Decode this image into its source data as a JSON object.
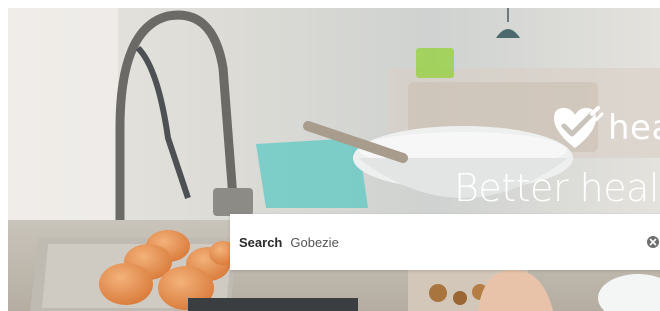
{
  "hero": {
    "background": "kitchen-photo-eggs-and-faucet",
    "brand": {
      "logo_icon": "heart-check-icon",
      "name": "hea"
    },
    "tagline": "Better heal"
  },
  "search": {
    "label": "Search",
    "value": "Gobezie",
    "clear_icon": "clear-circle-icon"
  },
  "colors": {
    "brand_text": "#ffffff",
    "search_bg": "#ffffff",
    "label_text": "#2b2b2b",
    "input_text": "#555555",
    "clear_icon": "#6e6e6e"
  }
}
